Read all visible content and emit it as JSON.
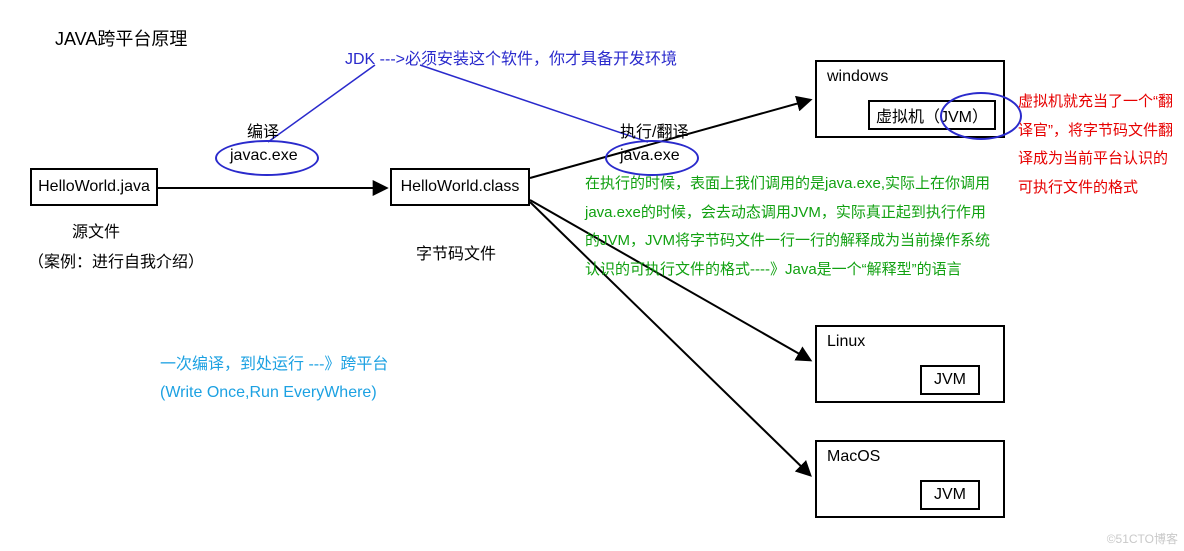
{
  "title": "JAVA跨平台原理",
  "source_box": "HelloWorld.java",
  "source_sub1": "源文件",
  "source_sub2": "（案例：进行自我介绍）",
  "compile_label": "编译",
  "javac_label": "javac.exe",
  "class_box": "HelloWorld.class",
  "class_sub": "字节码文件",
  "exec_label": "执行/翻译",
  "java_label": "java.exe",
  "jdk_note": "JDK  --->必须安装这个软件，你才具备开发环境",
  "os_windows": "windows",
  "os_linux": "Linux",
  "os_macos": "MacOS",
  "jvm_win": "虚拟机（JVM）",
  "jvm_label": "JVM",
  "green_text": "在执行的时候，表面上我们调用的是java.exe,实际上在你调用java.exe的时候，会去动态调用JVM，实际真正起到执行作用的JVM，JVM将字节码文件一行一行的解释成为当前操作系统认识的可执行文件的格式----》Java是一个“解释型”的语言",
  "red_text": "虚拟机就充当了一个“翻译官”，将字节码文件翻译成为当前平台认识的可执行文件的格式",
  "slogan_l1": "一次编译，到处运行  ---》跨平台",
  "slogan_l2": "(Write Once,Run EveryWhere)",
  "watermark": "©51CTO博客"
}
